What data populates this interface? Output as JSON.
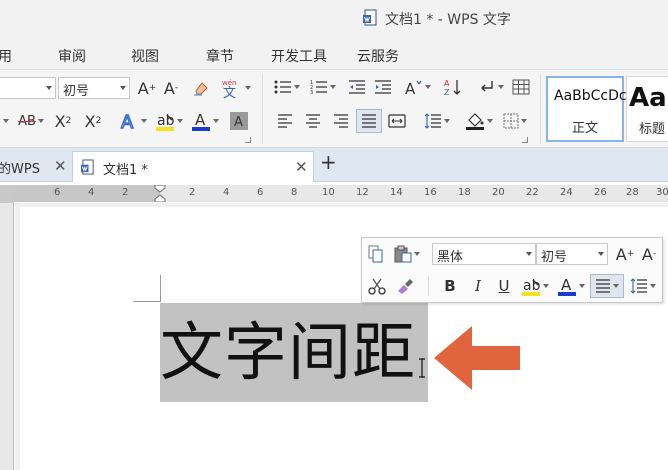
{
  "window": {
    "title": "文档1 * - WPS 文字"
  },
  "menu": [
    "用",
    "审阅",
    "视图",
    "章节",
    "开发工具",
    "云服务"
  ],
  "toolbar": {
    "font_size": "初号",
    "styles": [
      {
        "sample": "AaBbCcDc",
        "label": "正文"
      },
      {
        "sample": "Aa",
        "label": "标题"
      }
    ]
  },
  "tabs": [
    {
      "label": "的WPS"
    },
    {
      "label": "文档1 *"
    }
  ],
  "ruler": {
    "numbers": [
      "6",
      "4",
      "2",
      "2",
      "4",
      "6",
      "8",
      "10",
      "12",
      "14",
      "16",
      "18",
      "20",
      "22",
      "24",
      "26",
      "28",
      "30"
    ]
  },
  "document": {
    "text": "文字间距"
  },
  "mini_toolbar": {
    "font_name": "黑体",
    "font_size": "初号",
    "bold": "B",
    "italic": "I",
    "underline": "U"
  },
  "colors": {
    "arrow": "#e0653f",
    "font_color_bar": "#1a3cc8",
    "highlight_bar": "#f5e21a",
    "selection": "#c2c2c2"
  }
}
